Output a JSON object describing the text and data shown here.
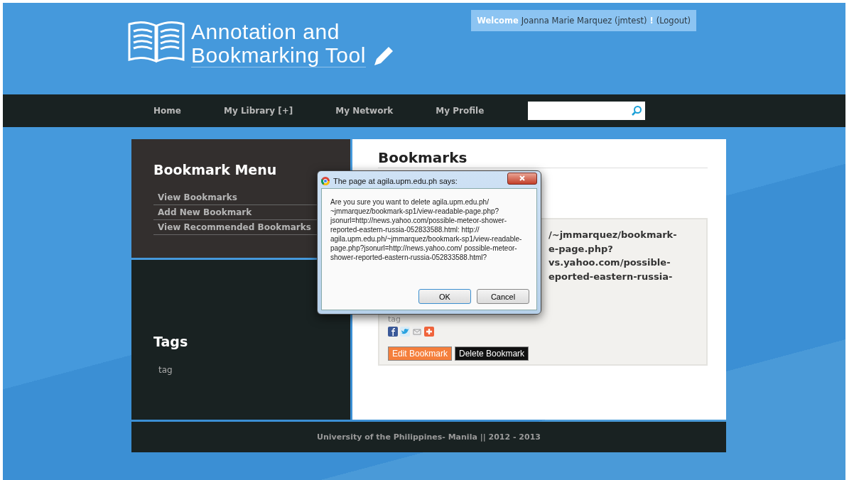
{
  "header": {
    "logo_line_1": "Annotation and",
    "logo_line_2": "Bookmarking Tool",
    "welcome_label": "Welcome",
    "user": "Joanna Marie Marquez (jmtest)",
    "exclaim": "!",
    "logout": "(Logout)"
  },
  "nav": {
    "items": [
      {
        "label": "Home",
        "selected": false
      },
      {
        "label": "My Library [+]",
        "selected": false
      },
      {
        "label": "My Network",
        "selected": false
      },
      {
        "label": "My Profile",
        "selected": false
      }
    ]
  },
  "sidebar": {
    "menu_title": "Bookmark Menu",
    "menu_items": [
      "View Bookmarks",
      "Add New Bookmark",
      "View Recommended Bookmarks"
    ],
    "tags_title": "Tags",
    "tags": [
      "tag"
    ]
  },
  "main": {
    "title": "Bookmarks",
    "bookmark_lines": [
      "/~jmmarquez/bookmark-",
      "e-page.php?",
      "vs.yahoo.com/possible-",
      "eported-eastern-russia-"
    ],
    "tag": "tag",
    "edit_button": "Edit Bookmark",
    "delete_button": "Delete Bookmark"
  },
  "footer": "University of the Philippines- Manila || 2012 - 2013",
  "dialog": {
    "title": "The page at agila.upm.edu.ph says:",
    "message": "Are you sure you want to delete agila.upm.edu.ph/ ~jmmarquez/bookmark-sp1/view-readable-page.php? jsonurl=http://news.yahoo.com/possible-meteor-shower-reported-eastern-russia-052833588.html: http:// agila.upm.edu.ph/~jmmarquez/bookmark-sp1/view-readable-page.php?jsonurl=http://news.yahoo.com/ possible-meteor-shower-reported-eastern-russia-052833588.html?",
    "ok": "OK",
    "cancel": "Cancel"
  }
}
